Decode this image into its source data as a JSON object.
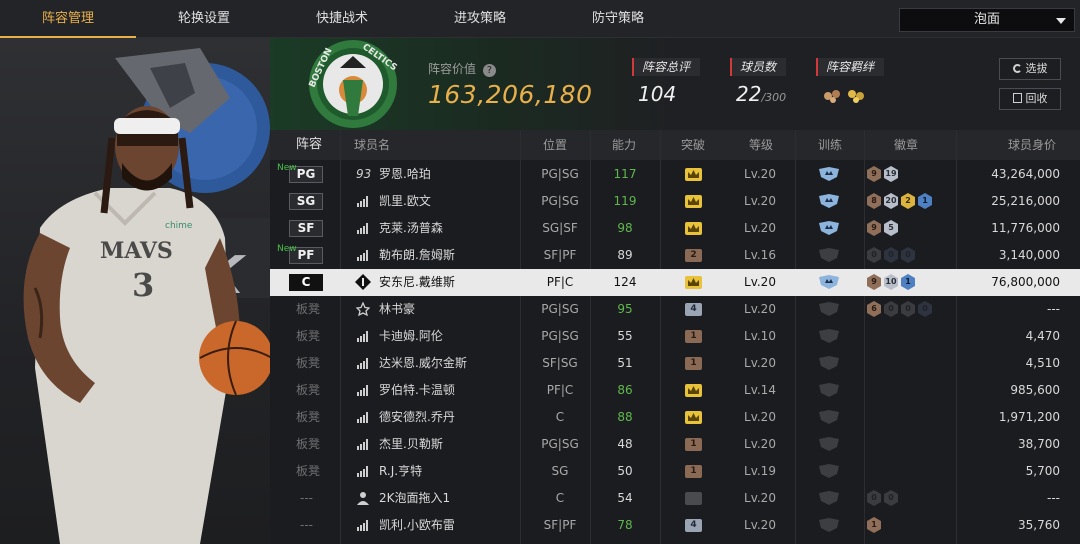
{
  "nav": {
    "tabs": [
      "阵容管理",
      "轮换设置",
      "快捷战术",
      "进攻策略",
      "防守策略"
    ],
    "active_index": 0,
    "dropdown_value": "泡面"
  },
  "team": {
    "value_label": "阵容价值",
    "value": "163,206,180",
    "rating_label": "阵容总评",
    "rating": "104",
    "players_label": "球员数",
    "players_count": "22",
    "players_max": "/300",
    "chem_label": "阵容羁绊",
    "btn_select": "选拔",
    "btn_recycle": "回收"
  },
  "colors": {
    "accent_gold": "#e8b04a",
    "green": "#5fb84d",
    "tag_red": "#d23a3a",
    "highlight_row": "#e9e9e9"
  },
  "table": {
    "headers": [
      "阵容",
      "球员名",
      "位置",
      "能力",
      "突破",
      "等级",
      "训练",
      "徽章",
      "球员身价"
    ],
    "rows": [
      {
        "slot": "PG",
        "is_new": true,
        "new_label": "New",
        "rank_icon": "93",
        "name": "罗恩.哈珀",
        "pos": "PG|SG",
        "ovr": "117",
        "ovr_green": true,
        "breakthrough": "gold",
        "bt_text": "",
        "level": "Lv.20",
        "training": "blue",
        "badges": [
          [
            "b",
            "9"
          ],
          [
            "s",
            "19"
          ]
        ],
        "value": "43,264,000"
      },
      {
        "slot": "SG",
        "is_new": false,
        "new_label": "",
        "rank_icon": "bars",
        "name": "凯里.欧文",
        "pos": "PG|SG",
        "ovr": "119",
        "ovr_green": true,
        "breakthrough": "gold",
        "bt_text": "",
        "level": "Lv.20",
        "training": "blue",
        "badges": [
          [
            "b",
            "8"
          ],
          [
            "s",
            "20"
          ],
          [
            "g",
            "2"
          ],
          [
            "bl",
            "1"
          ]
        ],
        "value": "25,216,000"
      },
      {
        "slot": "SF",
        "is_new": false,
        "new_label": "",
        "rank_icon": "bars",
        "name": "克莱.汤普森",
        "pos": "SG|SF",
        "ovr": "98",
        "ovr_green": true,
        "breakthrough": "gold",
        "bt_text": "",
        "level": "Lv.20",
        "training": "blue",
        "badges": [
          [
            "b",
            "9"
          ],
          [
            "s",
            "5"
          ]
        ],
        "value": "11,776,000"
      },
      {
        "slot": "PF",
        "is_new": true,
        "new_label": "New",
        "rank_icon": "bars",
        "name": "勒布朗.詹姆斯",
        "pos": "SF|PF",
        "ovr": "89",
        "ovr_green": false,
        "breakthrough": "bronze",
        "bt_text": "2",
        "level": "Lv.16",
        "training": "dark",
        "badges": [
          [
            "d",
            "0"
          ],
          [
            "dd",
            "0"
          ],
          [
            "dd",
            "0"
          ]
        ],
        "value": "3,140,000"
      },
      {
        "slot": "C",
        "is_new": false,
        "new_label": "",
        "rank_icon": "diamond",
        "name": "安东尼.戴维斯",
        "pos": "PF|C",
        "ovr": "124",
        "ovr_green": false,
        "breakthrough": "gold",
        "bt_text": "",
        "level": "Lv.20",
        "training": "blue",
        "badges": [
          [
            "b",
            "9"
          ],
          [
            "s",
            "10"
          ],
          [
            "bl",
            "1"
          ]
        ],
        "value": "76,800,000",
        "highlight": true
      },
      {
        "slot": "板凳",
        "is_new": false,
        "new_label": "",
        "rank_icon": "star",
        "name": "林书豪",
        "pos": "PG|SG",
        "ovr": "95",
        "ovr_green": true,
        "breakthrough": "silver",
        "bt_text": "4",
        "level": "Lv.20",
        "training": "dark",
        "badges": [
          [
            "b",
            "6"
          ],
          [
            "d",
            "0"
          ],
          [
            "d",
            "0"
          ],
          [
            "dd",
            "0"
          ]
        ],
        "value": "---"
      },
      {
        "slot": "板凳",
        "is_new": false,
        "new_label": "",
        "rank_icon": "bars",
        "name": "卡迪姆.阿伦",
        "pos": "PG|SG",
        "ovr": "55",
        "ovr_green": false,
        "breakthrough": "bronze",
        "bt_text": "1",
        "level": "Lv.10",
        "training": "dark",
        "badges": [],
        "value": "4,470"
      },
      {
        "slot": "板凳",
        "is_new": false,
        "new_label": "",
        "rank_icon": "bars",
        "name": "达米恩.威尔金斯",
        "pos": "SF|SG",
        "ovr": "51",
        "ovr_green": false,
        "breakthrough": "bronze",
        "bt_text": "1",
        "level": "Lv.20",
        "training": "dark",
        "badges": [],
        "value": "4,510"
      },
      {
        "slot": "板凳",
        "is_new": false,
        "new_label": "",
        "rank_icon": "bars",
        "name": "罗伯特.卡温顿",
        "pos": "PF|C",
        "ovr": "86",
        "ovr_green": true,
        "breakthrough": "gold",
        "bt_text": "",
        "level": "Lv.14",
        "training": "dark",
        "badges": [],
        "value": "985,600"
      },
      {
        "slot": "板凳",
        "is_new": false,
        "new_label": "",
        "rank_icon": "bars",
        "name": "德安德烈.乔丹",
        "pos": "C",
        "ovr": "88",
        "ovr_green": true,
        "breakthrough": "gold",
        "bt_text": "",
        "level": "Lv.20",
        "training": "dark",
        "badges": [],
        "value": "1,971,200"
      },
      {
        "slot": "板凳",
        "is_new": false,
        "new_label": "",
        "rank_icon": "bars",
        "name": "杰里.贝勒斯",
        "pos": "PG|SG",
        "ovr": "48",
        "ovr_green": false,
        "breakthrough": "bronze",
        "bt_text": "1",
        "level": "Lv.20",
        "training": "dark",
        "badges": [],
        "value": "38,700"
      },
      {
        "slot": "板凳",
        "is_new": false,
        "new_label": "",
        "rank_icon": "bars",
        "name": "R.J.亨特",
        "pos": "SG",
        "ovr": "50",
        "ovr_green": false,
        "breakthrough": "bronze",
        "bt_text": "1",
        "level": "Lv.19",
        "training": "dark",
        "badges": [],
        "value": "5,700"
      },
      {
        "slot": "---",
        "is_new": false,
        "new_label": "",
        "rank_icon": "person",
        "name": "2K泡面拖入1",
        "pos": "C",
        "ovr": "54",
        "ovr_green": false,
        "breakthrough": "dark",
        "bt_text": "",
        "level": "Lv.20",
        "training": "dark",
        "badges": [
          [
            "d",
            "0"
          ],
          [
            "d",
            "0"
          ]
        ],
        "value": "---"
      },
      {
        "slot": "---",
        "is_new": false,
        "new_label": "",
        "rank_icon": "bars",
        "name": "凯利.小欧布雷",
        "pos": "SF|PF",
        "ovr": "78",
        "ovr_green": true,
        "breakthrough": "silver",
        "bt_text": "4",
        "level": "Lv.20",
        "training": "dark",
        "badges": [
          [
            "b",
            "1"
          ]
        ],
        "value": "35,760"
      }
    ]
  }
}
